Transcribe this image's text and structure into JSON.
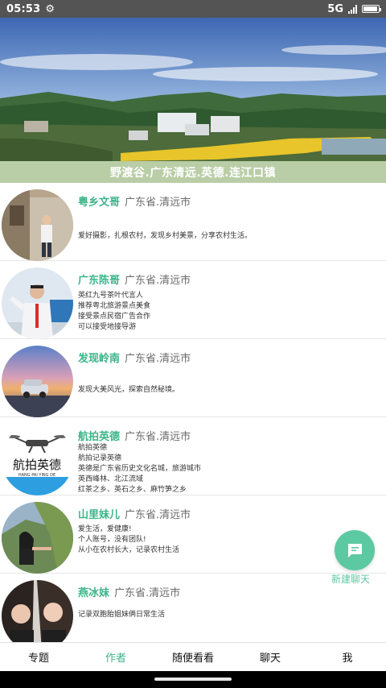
{
  "status_bar": {
    "time": "05:53",
    "network": "5G"
  },
  "banner": {
    "caption": "野渡谷.广东清远.英德.连江口镇"
  },
  "authors": [
    {
      "name": "粤乡文哥",
      "location": "广东省.清远市",
      "bio": "爱好摄影，扎根农村，发现乡村美景，分享农村生活。"
    },
    {
      "name": "广东陈哥",
      "location": "广东省.清远市",
      "bio": "英红九号茶叶代言人\n推荐粤北旅游景点美食\n接受景点民宿广告合作\n可以接受地接导游"
    },
    {
      "name": "发现岭南",
      "location": "广东省.清远市",
      "bio": "发现大美风光，探索自然秘境。"
    },
    {
      "name": "航拍英德",
      "location": "广东省.清远市",
      "bio": "航拍英德\n航拍记录英德\n英德是广东省历史文化名城，旅游城市\n英西峰林、北江流域\n红茶之乡、英石之乡、麻竹笋之乡",
      "avatar_text": "航拍英德",
      "avatar_subtext": "HANG PAI YING DE"
    },
    {
      "name": "山里妹儿",
      "location": "广东省.清远市",
      "bio": "爱生活，爱健康!\n个人账号，没有团队!\n从小在农村长大，记录农村生活"
    },
    {
      "name": "燕冰妹",
      "location": "广东省.清远市",
      "bio": "记录双胞胎姐妹俩日常生活"
    }
  ],
  "fab": {
    "label": "新建聊天",
    "icon": "chat-bubble-icon"
  },
  "bottom_nav": {
    "tabs": [
      "专题",
      "作者",
      "随便看看",
      "聊天",
      "我"
    ],
    "active": "作者"
  },
  "colors": {
    "accent": "#3bb589",
    "fab": "#5cc9a2",
    "caption_bg": "#b9cda6",
    "status_bar": "#545454"
  }
}
